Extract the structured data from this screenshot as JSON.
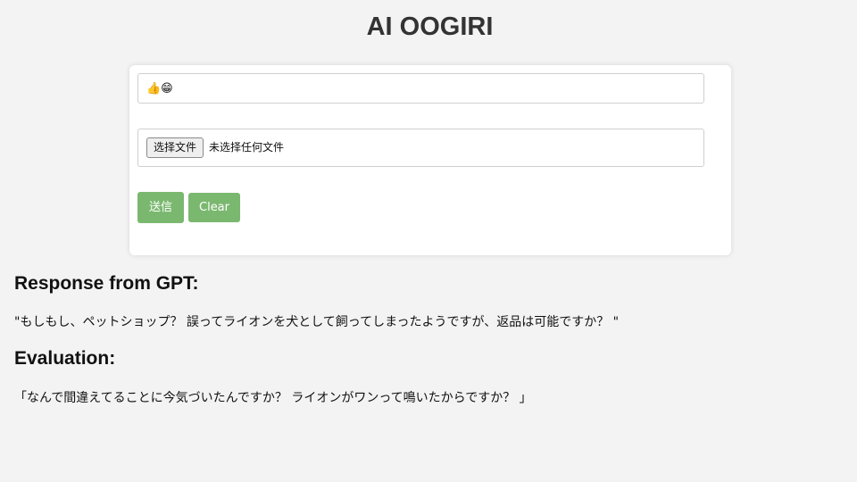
{
  "header": {
    "title": "AI OOGIRI"
  },
  "form": {
    "text_input_value": "👍😁",
    "file_button_label": "选择文件",
    "file_status": "未选择任何文件",
    "send_label": "送信",
    "clear_label": "Clear"
  },
  "response": {
    "heading": "Response from GPT:",
    "text": "\"もしもし、ペットショップ？ 誤ってライオンを犬として飼ってしまったようですが、返品は可能ですか？ \""
  },
  "evaluation": {
    "heading": "Evaluation:",
    "text": "「なんで間違えてることに今気づいたんですか？ ライオンがワンって鳴いたからですか？ 」"
  },
  "colors": {
    "background": "#f3f3f3",
    "button_green": "#7bb86f",
    "card": "#ffffff"
  }
}
